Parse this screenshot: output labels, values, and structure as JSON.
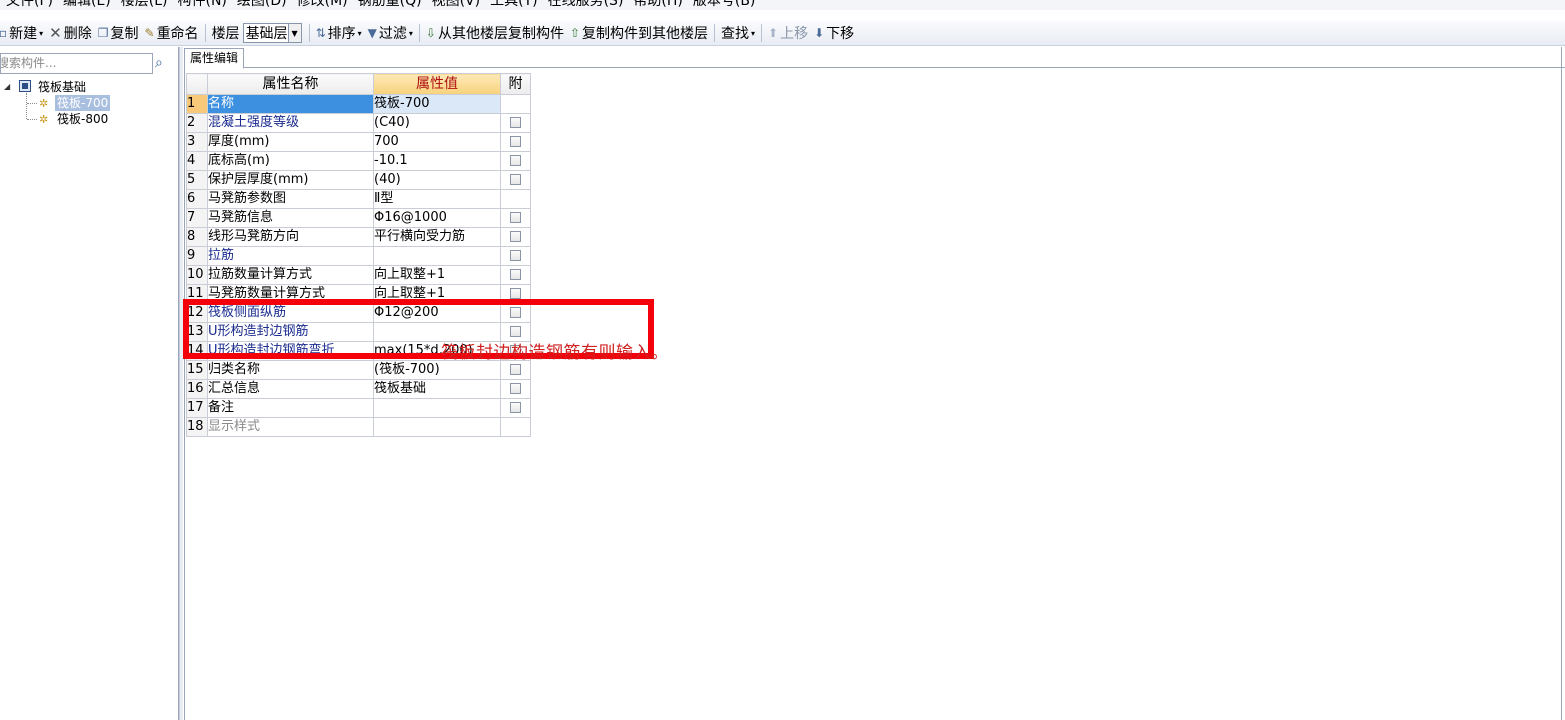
{
  "menu": [
    "文件(F)",
    "编辑(E)",
    "楼层(L)",
    "构件(N)",
    "绘图(D)",
    "修改(M)",
    "钢筋量(Q)",
    "视图(V)",
    "工具(T)",
    "在线服务(S)",
    "帮助(H)",
    "版本号(B)"
  ],
  "toolbar": {
    "new_label": "新建",
    "delete_label": "删除",
    "copy_label": "复制",
    "rename_label": "重命名",
    "floor_label": "楼层",
    "floor_value": "基础层",
    "sort_label": "排序",
    "filter_label": "过滤",
    "copy_from_label": "从其他楼层复制构件",
    "copy_to_label": "复制构件到其他楼层",
    "find_label": "查找",
    "move_up_label": "上移",
    "move_down_label": "下移"
  },
  "left_panel": {
    "search_placeholder": "搜索构件...",
    "tree_root": "筏板基础",
    "tree_items": [
      "筏板-700",
      "筏板-800"
    ]
  },
  "tab_label": "属性编辑",
  "grid": {
    "headers": [
      "属性名称",
      "属性值",
      "附"
    ],
    "rows": [
      {
        "n": "1",
        "name": "名称",
        "value": "筏板-700"
      },
      {
        "n": "2",
        "name": "混凝土强度等级",
        "value": "(C40)"
      },
      {
        "n": "3",
        "name": "厚度(mm)",
        "value": "700"
      },
      {
        "n": "4",
        "name": "底标高(m)",
        "value": "-10.1"
      },
      {
        "n": "5",
        "name": "保护层厚度(mm)",
        "value": "(40)"
      },
      {
        "n": "6",
        "name": "马凳筋参数图",
        "value": "Ⅱ型"
      },
      {
        "n": "7",
        "name": "马凳筋信息",
        "value": "Φ16@1000"
      },
      {
        "n": "8",
        "name": "线形马凳筋方向",
        "value": "平行横向受力筋"
      },
      {
        "n": "9",
        "name": "拉筋",
        "value": ""
      },
      {
        "n": "10",
        "name": "拉筋数量计算方式",
        "value": "向上取整+1"
      },
      {
        "n": "11",
        "name": "马凳筋数量计算方式",
        "value": "向上取整+1"
      },
      {
        "n": "12",
        "name": "筏板侧面纵筋",
        "value": "Φ12@200"
      },
      {
        "n": "13",
        "name": "U形构造封边钢筋",
        "value": ""
      },
      {
        "n": "14",
        "name": "U形构造封边钢筋弯折",
        "value": "max(15*d,200)"
      },
      {
        "n": "15",
        "name": "归类名称",
        "value": "(筏板-700)"
      },
      {
        "n": "16",
        "name": "汇总信息",
        "value": "筏板基础"
      },
      {
        "n": "17",
        "name": "备注",
        "value": ""
      },
      {
        "n": "18",
        "name": "显示样式",
        "value": ""
      }
    ]
  },
  "annotation": "筏板封边构造钢筋有则输入。",
  "colors": {
    "highlight_box": "#f3000a",
    "annotation_text": "#d02020",
    "selected_name": "#3d8fe0"
  }
}
